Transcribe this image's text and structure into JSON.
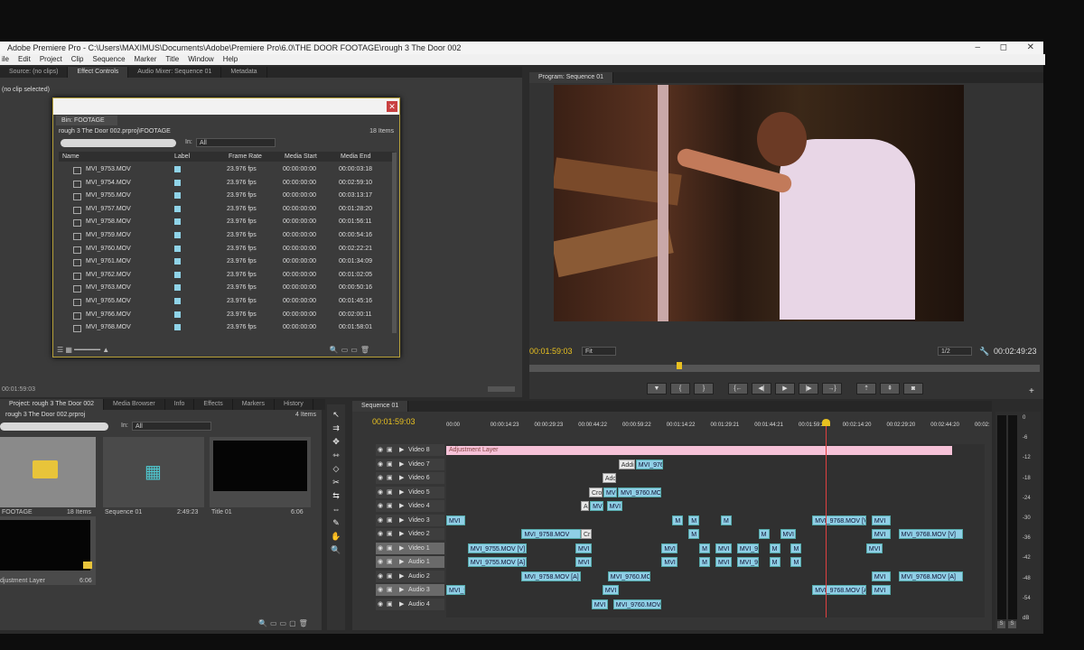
{
  "window": {
    "title": "Adobe Premiere Pro - C:\\Users\\MAXIMUS\\Documents\\Adobe\\Premiere Pro\\6.0\\THE DOOR FOOTAGE\\rough 3 The Door 002",
    "controls": [
      "–",
      "◻",
      "✕"
    ]
  },
  "menu": [
    "ile",
    "Edit",
    "Project",
    "Clip",
    "Sequence",
    "Marker",
    "Title",
    "Window",
    "Help"
  ],
  "source_panel": {
    "tabs": [
      "Source: (no clips)",
      "Effect Controls",
      "Audio Mixer: Sequence 01",
      "Metadata"
    ],
    "no_clip": "(no clip selected)",
    "timecode": "00:01:59:03"
  },
  "bin": {
    "tab": "Bin: FOOTAGE",
    "path": "rough 3 The Door 002.prproj\\FOOTAGE",
    "count": "18 Items",
    "in_label": "In:",
    "in_value": "All",
    "columns": [
      "Name",
      "Label",
      "Frame Rate",
      "Media Start",
      "Media End"
    ],
    "rows": [
      {
        "name": "MVI_9753.MOV",
        "fps": "23.976 fps",
        "start": "00:00:00:00",
        "end": "00:00:03:18"
      },
      {
        "name": "MVI_9754.MOV",
        "fps": "23.976 fps",
        "start": "00:00:00:00",
        "end": "00:02:59:10"
      },
      {
        "name": "MVI_9755.MOV",
        "fps": "23.976 fps",
        "start": "00:00:00:00",
        "end": "00:03:13:17"
      },
      {
        "name": "MVI_9757.MOV",
        "fps": "23.976 fps",
        "start": "00:00:00:00",
        "end": "00:01:28:20"
      },
      {
        "name": "MVI_9758.MOV",
        "fps": "23.976 fps",
        "start": "00:00:00:00",
        "end": "00:01:56:11"
      },
      {
        "name": "MVI_9759.MOV",
        "fps": "23.976 fps",
        "start": "00:00:00:00",
        "end": "00:00:54:16"
      },
      {
        "name": "MVI_9760.MOV",
        "fps": "23.976 fps",
        "start": "00:00:00:00",
        "end": "00:02:22:21"
      },
      {
        "name": "MVI_9761.MOV",
        "fps": "23.976 fps",
        "start": "00:00:00:00",
        "end": "00:01:34:09"
      },
      {
        "name": "MVI_9762.MOV",
        "fps": "23.976 fps",
        "start": "00:00:00:00",
        "end": "00:01:02:05"
      },
      {
        "name": "MVI_9763.MOV",
        "fps": "23.976 fps",
        "start": "00:00:00:00",
        "end": "00:00:50:16"
      },
      {
        "name": "MVI_9765.MOV",
        "fps": "23.976 fps",
        "start": "00:00:00:00",
        "end": "00:01:45:16"
      },
      {
        "name": "MVI_9766.MOV",
        "fps": "23.976 fps",
        "start": "00:00:00:00",
        "end": "00:02:00:11"
      },
      {
        "name": "MVI_9768.MOV",
        "fps": "23.976 fps",
        "start": "00:00:00:00",
        "end": "00:01:58:01"
      }
    ]
  },
  "program": {
    "tab": "Program: Sequence 01",
    "timecode": "00:01:59:03",
    "fit": "Fit",
    "quality": "1/2",
    "duration": "00:02:49:23",
    "playhead_fraction": 0.7
  },
  "project": {
    "tabs": [
      "Project: rough 3 The Door 002",
      "Media Browser",
      "Info",
      "Effects",
      "Markers",
      "History"
    ],
    "file": "rough 3 The Door 002.prproj",
    "count": "4 Items",
    "in_label": "In:",
    "in_value": "All",
    "items": [
      {
        "name": "FOOTAGE",
        "info": "18 Items"
      },
      {
        "name": "Sequence 01",
        "info": "2:49:23"
      },
      {
        "name": "Title 01",
        "info": "6:06"
      },
      {
        "name": "djustment Layer",
        "info": "6:06"
      }
    ]
  },
  "timeline": {
    "tab": "Sequence 01",
    "timecode": "00:01:59:03",
    "ruler": [
      "00:00",
      "00:00:14:23",
      "00:00:29:23",
      "00:00:44:22",
      "00:00:59:22",
      "00:01:14:22",
      "00:01:29:21",
      "00:01:44:21",
      "00:01:59:21",
      "00:02:14:20",
      "00:02:29:20",
      "00:02:44:20",
      "00:02:"
    ],
    "tracks": [
      "Video 8",
      "Video 7",
      "Video 6",
      "Video 5",
      "Video 4",
      "Video 3",
      "Video 2",
      "Video 1",
      "Audio 1",
      "Audio 2",
      "Audio 3",
      "Audio 4"
    ],
    "adjustment_label": "Adjustment Layer",
    "clips": [
      {
        "track": 1,
        "label": "Addi",
        "kind": "white",
        "s": 0.32,
        "w": 0.03
      },
      {
        "track": 1,
        "label": "MVI_976",
        "kind": "clip",
        "s": 0.352,
        "w": 0.05
      },
      {
        "track": 2,
        "label": "Ado",
        "kind": "white",
        "s": 0.29,
        "w": 0.025
      },
      {
        "track": 3,
        "label": "Cro",
        "kind": "white",
        "s": 0.265,
        "w": 0.025
      },
      {
        "track": 3,
        "label": "MVI",
        "kind": "clip",
        "s": 0.292,
        "w": 0.025
      },
      {
        "track": 3,
        "label": "MVI_9760.MO",
        "kind": "clip",
        "s": 0.319,
        "w": 0.08
      },
      {
        "track": 4,
        "label": "A",
        "kind": "white",
        "s": 0.25,
        "w": 0.015
      },
      {
        "track": 4,
        "label": "MVI",
        "kind": "clip",
        "s": 0.267,
        "w": 0.025
      },
      {
        "track": 4,
        "label": "MVI",
        "kind": "clip",
        "s": 0.298,
        "w": 0.03
      },
      {
        "track": 5,
        "label": "MVI",
        "kind": "clip",
        "s": 0.0,
        "w": 0.035
      },
      {
        "track": 5,
        "label": "M",
        "kind": "clip",
        "s": 0.42,
        "w": 0.02
      },
      {
        "track": 5,
        "label": "M",
        "kind": "clip",
        "s": 0.45,
        "w": 0.02
      },
      {
        "track": 5,
        "label": "M",
        "kind": "clip",
        "s": 0.51,
        "w": 0.02
      },
      {
        "track": 5,
        "label": "MVI_9768.MOV [V]",
        "kind": "clip",
        "s": 0.68,
        "w": 0.1
      },
      {
        "track": 5,
        "label": "MVI",
        "kind": "clip",
        "s": 0.79,
        "w": 0.035
      },
      {
        "track": 6,
        "label": "MVI_9758.MOV",
        "kind": "clip",
        "s": 0.14,
        "w": 0.11
      },
      {
        "track": 6,
        "label": "Cr",
        "kind": "white",
        "s": 0.25,
        "w": 0.02
      },
      {
        "track": 6,
        "label": "M",
        "kind": "clip",
        "s": 0.45,
        "w": 0.02
      },
      {
        "track": 6,
        "label": "M",
        "kind": "clip",
        "s": 0.58,
        "w": 0.02
      },
      {
        "track": 6,
        "label": "MVI",
        "kind": "clip",
        "s": 0.62,
        "w": 0.03
      },
      {
        "track": 6,
        "label": "MVI",
        "kind": "clip",
        "s": 0.79,
        "w": 0.035
      },
      {
        "track": 6,
        "label": "MVI_9768.MOV [V]",
        "kind": "clip",
        "s": 0.84,
        "w": 0.12
      },
      {
        "track": 7,
        "label": "MVI_9755.MOV [V]",
        "kind": "clip",
        "s": 0.04,
        "w": 0.11
      },
      {
        "track": 7,
        "label": "MVI",
        "kind": "clip",
        "s": 0.24,
        "w": 0.03
      },
      {
        "track": 7,
        "label": "MVI",
        "kind": "clip",
        "s": 0.4,
        "w": 0.03
      },
      {
        "track": 7,
        "label": "M",
        "kind": "clip",
        "s": 0.47,
        "w": 0.02
      },
      {
        "track": 7,
        "label": "MVI",
        "kind": "clip",
        "s": 0.5,
        "w": 0.03
      },
      {
        "track": 7,
        "label": "MVI_9",
        "kind": "clip",
        "s": 0.54,
        "w": 0.04
      },
      {
        "track": 7,
        "label": "M",
        "kind": "clip",
        "s": 0.6,
        "w": 0.02
      },
      {
        "track": 7,
        "label": "M",
        "kind": "clip",
        "s": 0.64,
        "w": 0.02
      },
      {
        "track": 7,
        "label": "MVI",
        "kind": "clip",
        "s": 0.78,
        "w": 0.03
      },
      {
        "track": 8,
        "label": "MVI_9755.MOV [A]",
        "kind": "clip",
        "s": 0.04,
        "w": 0.11
      },
      {
        "track": 8,
        "label": "MVI",
        "kind": "clip",
        "s": 0.24,
        "w": 0.03
      },
      {
        "track": 8,
        "label": "MVI",
        "kind": "clip",
        "s": 0.4,
        "w": 0.03
      },
      {
        "track": 8,
        "label": "M",
        "kind": "clip",
        "s": 0.47,
        "w": 0.02
      },
      {
        "track": 8,
        "label": "MVI",
        "kind": "clip",
        "s": 0.5,
        "w": 0.03
      },
      {
        "track": 8,
        "label": "MVI_9",
        "kind": "clip",
        "s": 0.54,
        "w": 0.04
      },
      {
        "track": 8,
        "label": "M",
        "kind": "clip",
        "s": 0.6,
        "w": 0.02
      },
      {
        "track": 8,
        "label": "M",
        "kind": "clip",
        "s": 0.64,
        "w": 0.02
      },
      {
        "track": 9,
        "label": "MVI_9758.MOV [A]",
        "kind": "clip",
        "s": 0.14,
        "w": 0.11
      },
      {
        "track": 9,
        "label": "MVI_9760.MO",
        "kind": "clip",
        "s": 0.3,
        "w": 0.08
      },
      {
        "track": 9,
        "label": "MVI",
        "kind": "clip",
        "s": 0.79,
        "w": 0.035
      },
      {
        "track": 9,
        "label": "MVI_9768.MOV [A]",
        "kind": "clip",
        "s": 0.84,
        "w": 0.12
      },
      {
        "track": 10,
        "label": "MVI_9",
        "kind": "clip",
        "s": 0.0,
        "w": 0.035
      },
      {
        "track": 10,
        "label": "MVI",
        "kind": "clip",
        "s": 0.29,
        "w": 0.03
      },
      {
        "track": 10,
        "label": "MVI_9768.MOV [A]",
        "kind": "clip",
        "s": 0.68,
        "w": 0.1
      },
      {
        "track": 10,
        "label": "MVI",
        "kind": "clip",
        "s": 0.79,
        "w": 0.035
      },
      {
        "track": 11,
        "label": "MVI",
        "kind": "clip",
        "s": 0.27,
        "w": 0.03
      },
      {
        "track": 11,
        "label": "MVI_9760.MOV",
        "kind": "clip",
        "s": 0.31,
        "w": 0.09
      }
    ],
    "playhead_fraction": 0.705
  },
  "audio_meter": {
    "scale": [
      "0",
      "-6",
      "-12",
      "-18",
      "-24",
      "-30",
      "-36",
      "-42",
      "-48",
      "-54",
      "dB"
    ],
    "buttons": [
      "S",
      "S"
    ]
  },
  "colors": {
    "clip": "#8fcfe6",
    "adjustment": "#f6c2d8",
    "timecode": "#e8c020",
    "playhead": "#e04040"
  }
}
